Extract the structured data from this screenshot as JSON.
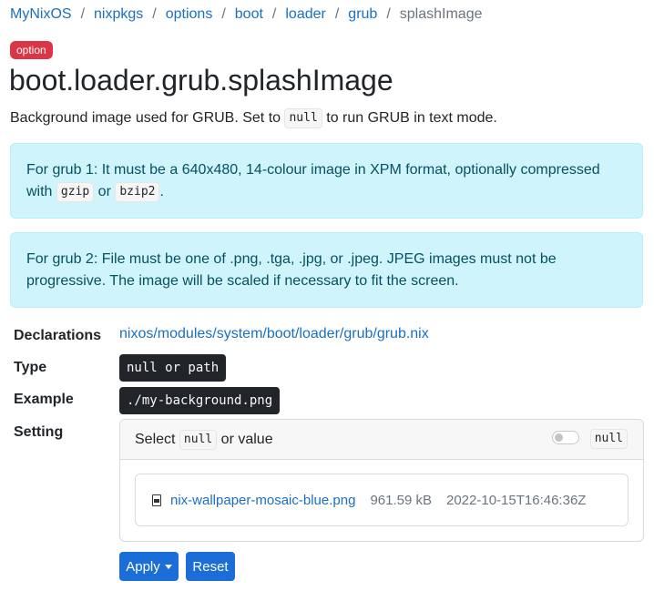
{
  "breadcrumb": {
    "items": [
      "MyNixOS",
      "nixpkgs",
      "options",
      "boot",
      "loader",
      "grub"
    ],
    "current": "splashImage",
    "separator": "/"
  },
  "badge": "option",
  "title": "boot.loader.grub.splashImage",
  "description": {
    "before": "Background image used for GRUB. Set to ",
    "code": "null",
    "after": " to run GRUB in text mode."
  },
  "alerts": [
    {
      "text": "For grub 1: It must be a 640x480, 14-colour image in XPM format, optionally compressed with ",
      "code1": "gzip",
      "mid": " or ",
      "code2": "bzip2",
      "end": "."
    },
    {
      "text": "For grub 2: File must be one of .png, .tga, .jpg, or .jpeg. JPEG images must not be progressive. The image will be scaled if necessary to fit the screen."
    }
  ],
  "details": {
    "declarations_label": "Declarations",
    "declarations_value": "nixos/modules/system/boot/loader/grub/grub.nix",
    "type_label": "Type",
    "type_value": "null or path",
    "example_label": "Example",
    "example_value": "./my-background.png",
    "setting_label": "Setting"
  },
  "setting": {
    "select_before": "Select ",
    "select_code": "null",
    "select_after": " or value",
    "null_toggle_on": false,
    "null_tag": "null",
    "file": {
      "icon": "file-image-icon",
      "name": "nix-wallpaper-mosaic-blue.png",
      "size": "961.59 kB",
      "date": "2022-10-15T16:46:36Z"
    }
  },
  "buttons": {
    "apply": "Apply",
    "reset": "Reset"
  },
  "colors": {
    "link": "#1a6fc4",
    "badge": "#dc3545",
    "alert_bg": "#cff4fc",
    "button": "#1b6ed8"
  }
}
